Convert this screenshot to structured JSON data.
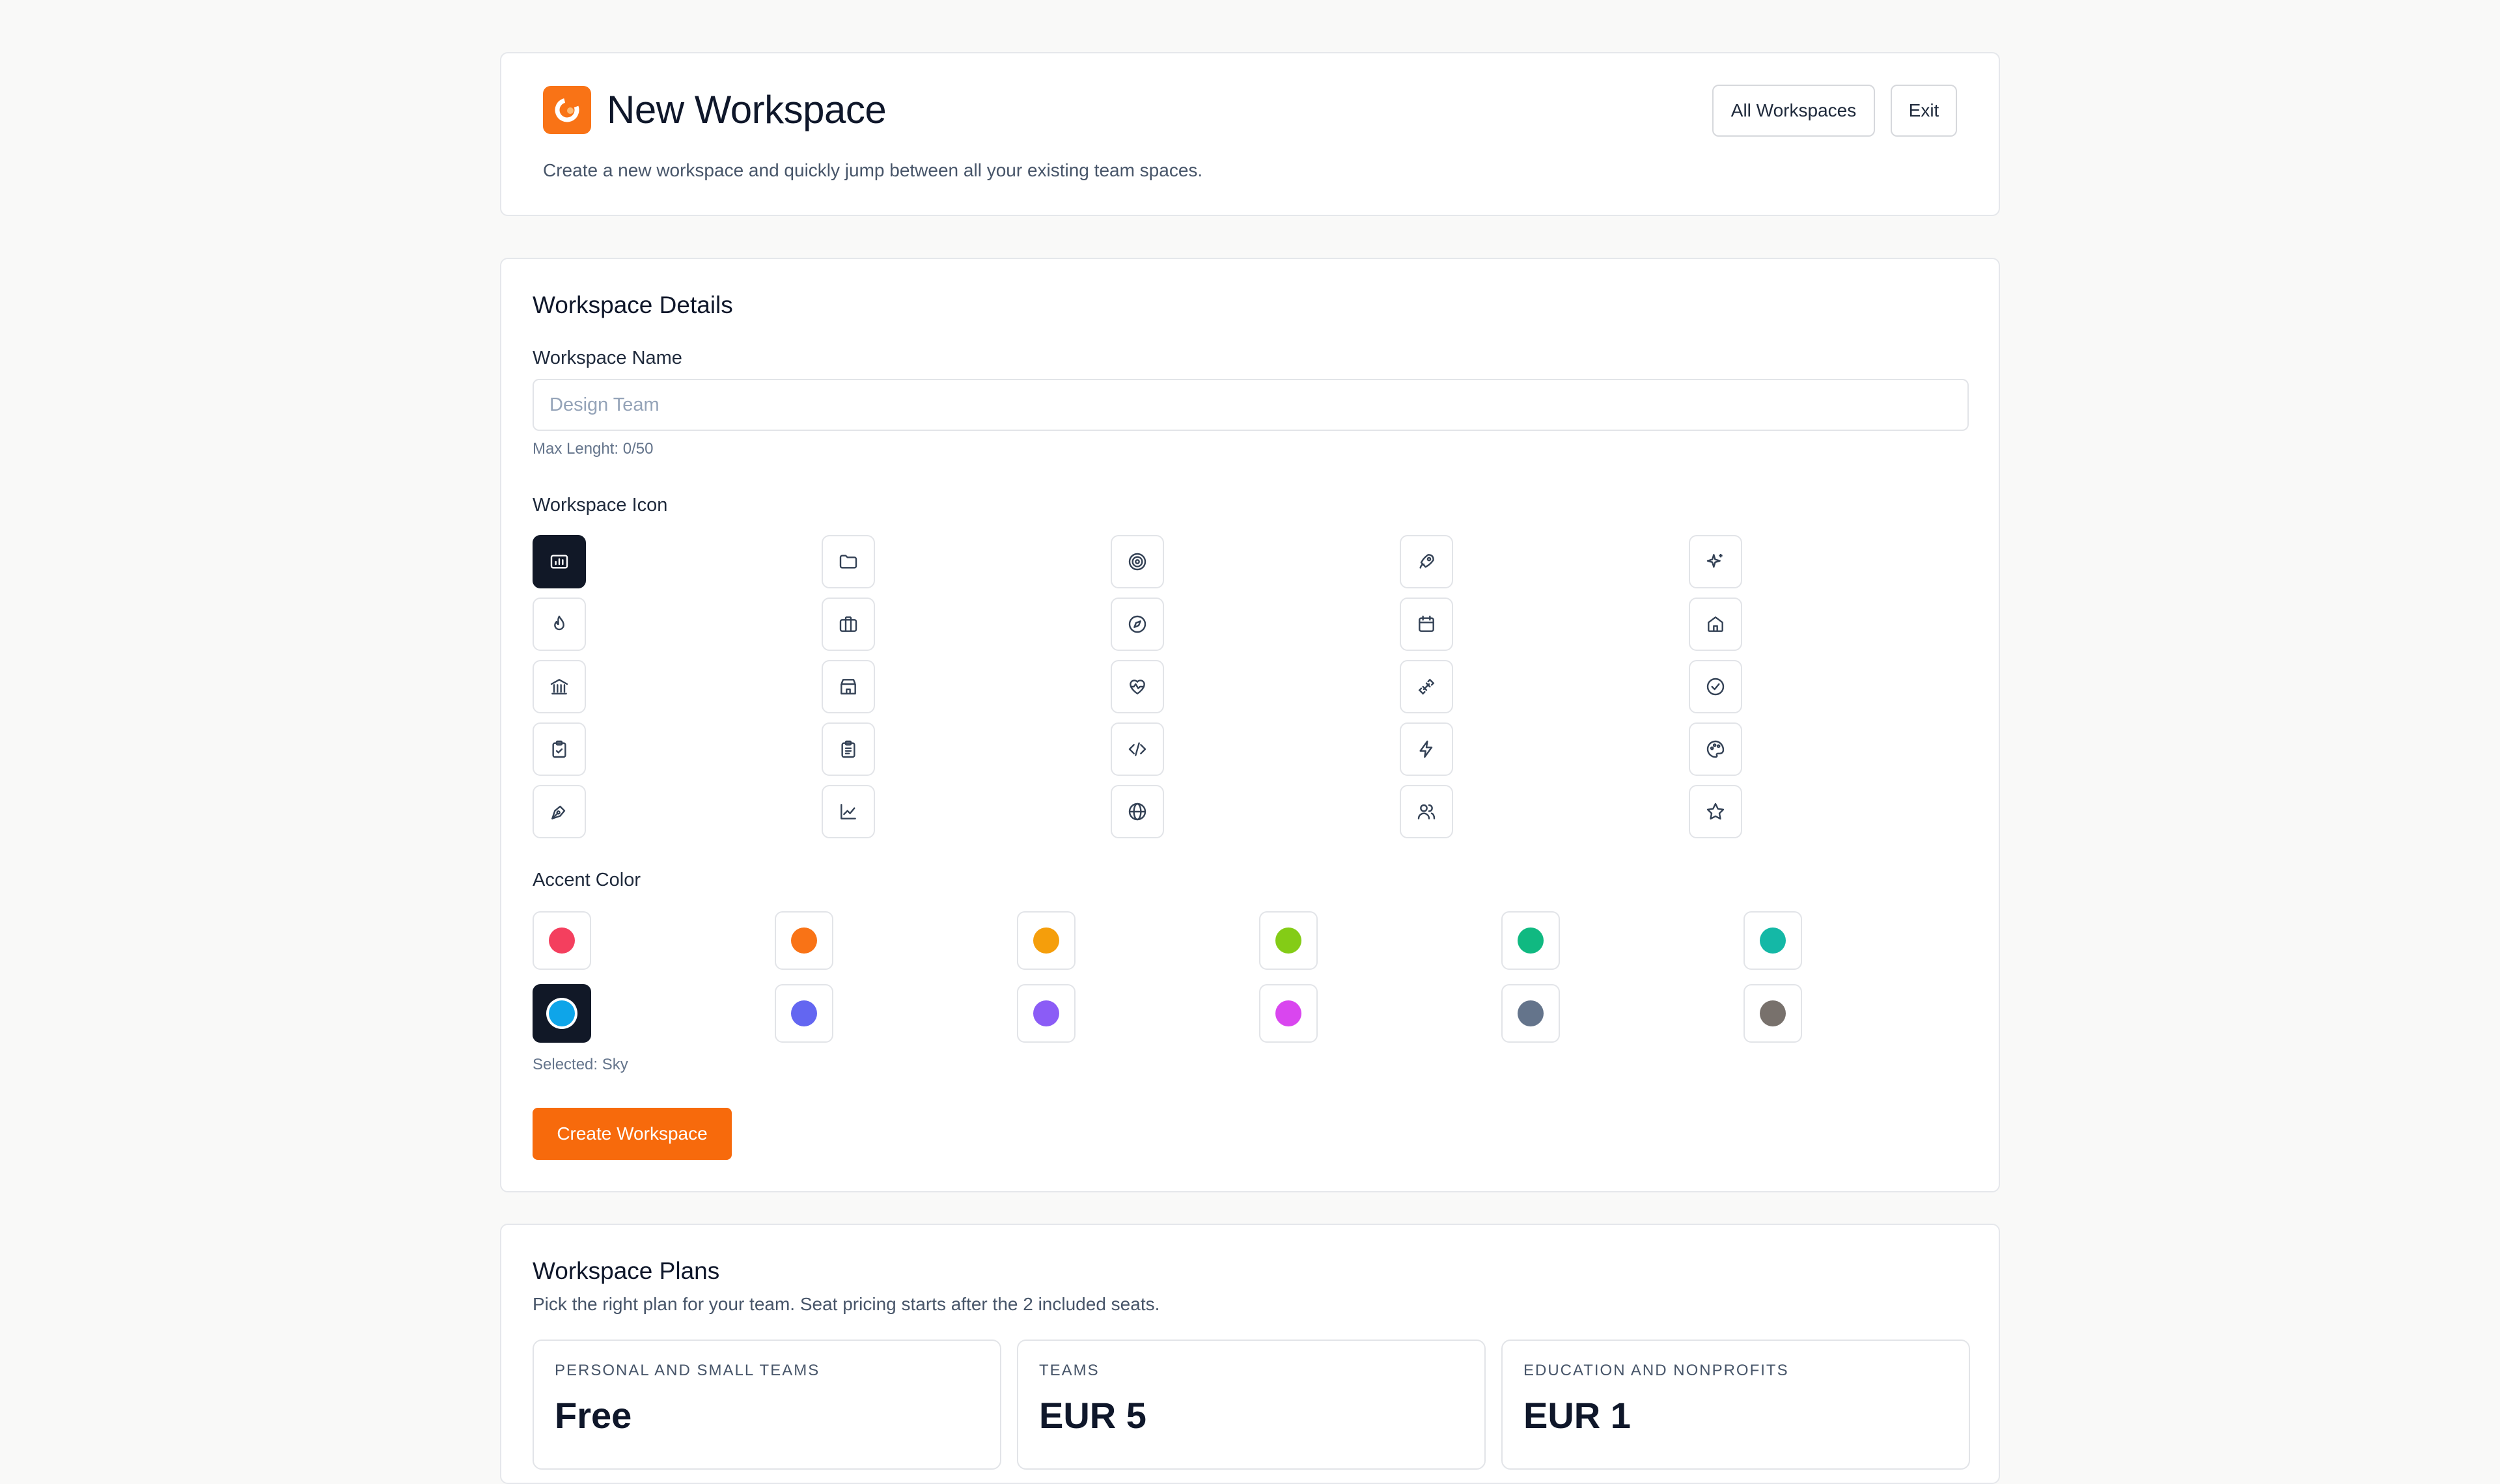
{
  "header": {
    "title": "New Workspace",
    "description": "Create a new workspace and quickly jump between all your existing team spaces.",
    "all_workspaces_label": "All Workspaces",
    "exit_label": "Exit",
    "logo_icon": "brand-logo-icon",
    "brand_color": "#f97316"
  },
  "details": {
    "title": "Workspace Details",
    "name_label": "Workspace Name",
    "name_placeholder": "Design Team",
    "name_value": "",
    "max_length_hint": "Max Lenght: 0/50",
    "icon_label": "Workspace Icon",
    "icons": [
      "chart-folder-icon",
      "folder-icon",
      "target-icon",
      "rocket-icon",
      "sparkles-icon",
      "flame-icon",
      "briefcase-icon",
      "compass-icon",
      "calendar-icon",
      "home-icon",
      "landmark-icon",
      "store-icon",
      "heart-pulse-icon",
      "dumbbell-icon",
      "check-circle-icon",
      "clipboard-check-icon",
      "clipboard-list-icon",
      "code-icon",
      "zap-icon",
      "palette-icon",
      "pen-tool-icon",
      "line-chart-icon",
      "globe-icon",
      "users-icon",
      "star-icon"
    ],
    "selected_icon": "chart-folder-icon",
    "accent_label": "Accent Color",
    "colors": [
      {
        "name": "Rose",
        "hex": "#f43f5e"
      },
      {
        "name": "Orange",
        "hex": "#f97316"
      },
      {
        "name": "Amber",
        "hex": "#f59e0b"
      },
      {
        "name": "Lime",
        "hex": "#84cc16"
      },
      {
        "name": "Emerald",
        "hex": "#10b981"
      },
      {
        "name": "Teal",
        "hex": "#14b8a6"
      },
      {
        "name": "Sky",
        "hex": "#0ea5e9"
      },
      {
        "name": "Indigo",
        "hex": "#6366f1"
      },
      {
        "name": "Violet",
        "hex": "#8b5cf6"
      },
      {
        "name": "Fuchsia",
        "hex": "#d946ef"
      },
      {
        "name": "Slate",
        "hex": "#64748b"
      },
      {
        "name": "Stone",
        "hex": "#78716c"
      }
    ],
    "selected_color_text": "Selected: Sky",
    "create_label": "Create Workspace",
    "create_color": "#f76a0c"
  },
  "plans": {
    "title": "Workspace Plans",
    "description": "Pick the right plan for your team. Seat pricing starts after the 2 included seats.",
    "items": [
      {
        "name": "PERSONAL AND SMALL TEAMS",
        "price": "Free"
      },
      {
        "name": "TEAMS",
        "price": "EUR 5"
      },
      {
        "name": "EDUCATION AND NONPROFITS",
        "price": "EUR 1"
      }
    ]
  }
}
